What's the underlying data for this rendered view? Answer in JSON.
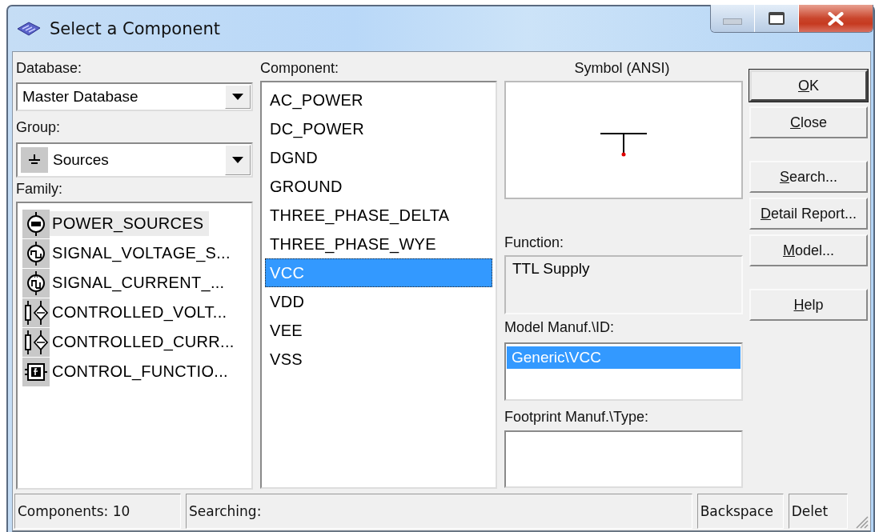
{
  "window": {
    "title": "Select a Component"
  },
  "database": {
    "label": "Database:",
    "value": "Master Database"
  },
  "group": {
    "label": "Group:",
    "value": "Sources"
  },
  "family": {
    "label": "Family:",
    "items": [
      {
        "name": "POWER_SOURCES",
        "kind": "power",
        "selected": true
      },
      {
        "name": "SIGNAL_VOLTAGE_S...",
        "kind": "voltage",
        "selected": false
      },
      {
        "name": "SIGNAL_CURRENT_...",
        "kind": "current",
        "selected": false
      },
      {
        "name": "CONTROLLED_VOLT...",
        "kind": "controlled",
        "selected": false
      },
      {
        "name": "CONTROLLED_CURR...",
        "kind": "controlled",
        "selected": false
      },
      {
        "name": "CONTROL_FUNCTIO...",
        "kind": "function",
        "selected": false
      }
    ]
  },
  "component": {
    "label": "Component:",
    "items": [
      {
        "name": "AC_POWER",
        "selected": false
      },
      {
        "name": "DC_POWER",
        "selected": false
      },
      {
        "name": "DGND",
        "selected": false
      },
      {
        "name": "GROUND",
        "selected": false
      },
      {
        "name": "THREE_PHASE_DELTA",
        "selected": false
      },
      {
        "name": "THREE_PHASE_WYE",
        "selected": false
      },
      {
        "name": "VCC",
        "selected": true
      },
      {
        "name": "VDD",
        "selected": false
      },
      {
        "name": "VEE",
        "selected": false
      },
      {
        "name": "VSS",
        "selected": false
      }
    ]
  },
  "symbol": {
    "label": "Symbol (ANSI)"
  },
  "function": {
    "label": "Function:",
    "value": "TTL Supply"
  },
  "model": {
    "label": "Model Manuf.\\ID:",
    "items": [
      {
        "name": "Generic\\VCC",
        "selected": true
      }
    ]
  },
  "footprint": {
    "label": "Footprint Manuf.\\Type:"
  },
  "button_groups": [
    [
      {
        "label": "OK",
        "underline_first": true,
        "default": true
      },
      {
        "label": "Close",
        "underline_first": true,
        "default": false
      }
    ],
    [
      {
        "label": "Search...",
        "underline_first": true,
        "default": false
      },
      {
        "label": "Detail Report...",
        "underline_first": true,
        "default": false
      },
      {
        "label": "Model...",
        "underline_first": true,
        "default": false
      }
    ],
    [
      {
        "label": "Help",
        "underline_first": true,
        "default": false
      }
    ]
  ],
  "status_bar": [
    {
      "text": "Components: 10"
    },
    {
      "text": "Searching:"
    },
    {
      "text": "Backspace"
    },
    {
      "text": "Delet"
    }
  ]
}
